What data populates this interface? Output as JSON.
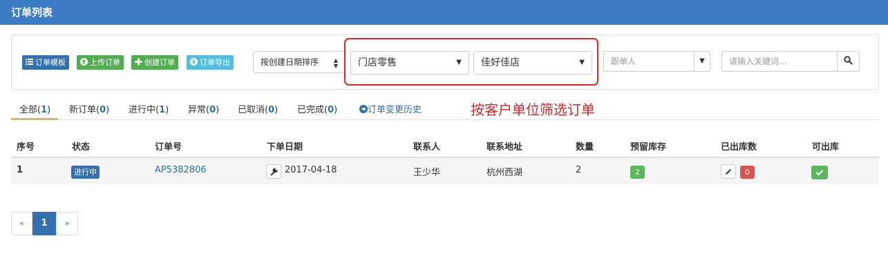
{
  "title": "订单列表",
  "toolbar": {
    "template_label": "订单模板",
    "upload_label": "上传订单",
    "create_label": "创建订单",
    "export_label": "订单导出"
  },
  "filters": {
    "sort_value": "按创建日期排序",
    "channel_value": "门店零售",
    "customer_value": "佳好佳店",
    "follower_placeholder": "跟单人",
    "keyword_placeholder": "请输入关键词..."
  },
  "tabs": [
    {
      "label": "全部",
      "count": "1"
    },
    {
      "label": "新订单",
      "count": "0"
    },
    {
      "label": "进行中",
      "count": "1"
    },
    {
      "label": "异常",
      "count": "0"
    },
    {
      "label": "已取消",
      "count": "0"
    },
    {
      "label": "已完成",
      "count": "0"
    }
  ],
  "history_label": "订单变更历史",
  "annotation": "按客户单位筛选订单",
  "table": {
    "headers": [
      "序号",
      "状态",
      "订单号",
      "下单日期",
      "联系人",
      "联系地址",
      "数量",
      "预留库存",
      "已出库数",
      "可出库"
    ],
    "rows": [
      {
        "index": "1",
        "status": "进行中",
        "order_no": "AP5382806",
        "date": "2017-04-18",
        "contact": "王少华",
        "address": "杭州西湖",
        "qty": "2",
        "reserved": "2",
        "shipped": "0"
      }
    ]
  },
  "pagination": {
    "prev": "«",
    "current": "1",
    "next": "»"
  },
  "colors": {
    "header": "#3c7cc4",
    "primary": "#336fb1",
    "success": "#5cb85c",
    "danger": "#d9534f",
    "annotation": "#e32222"
  }
}
